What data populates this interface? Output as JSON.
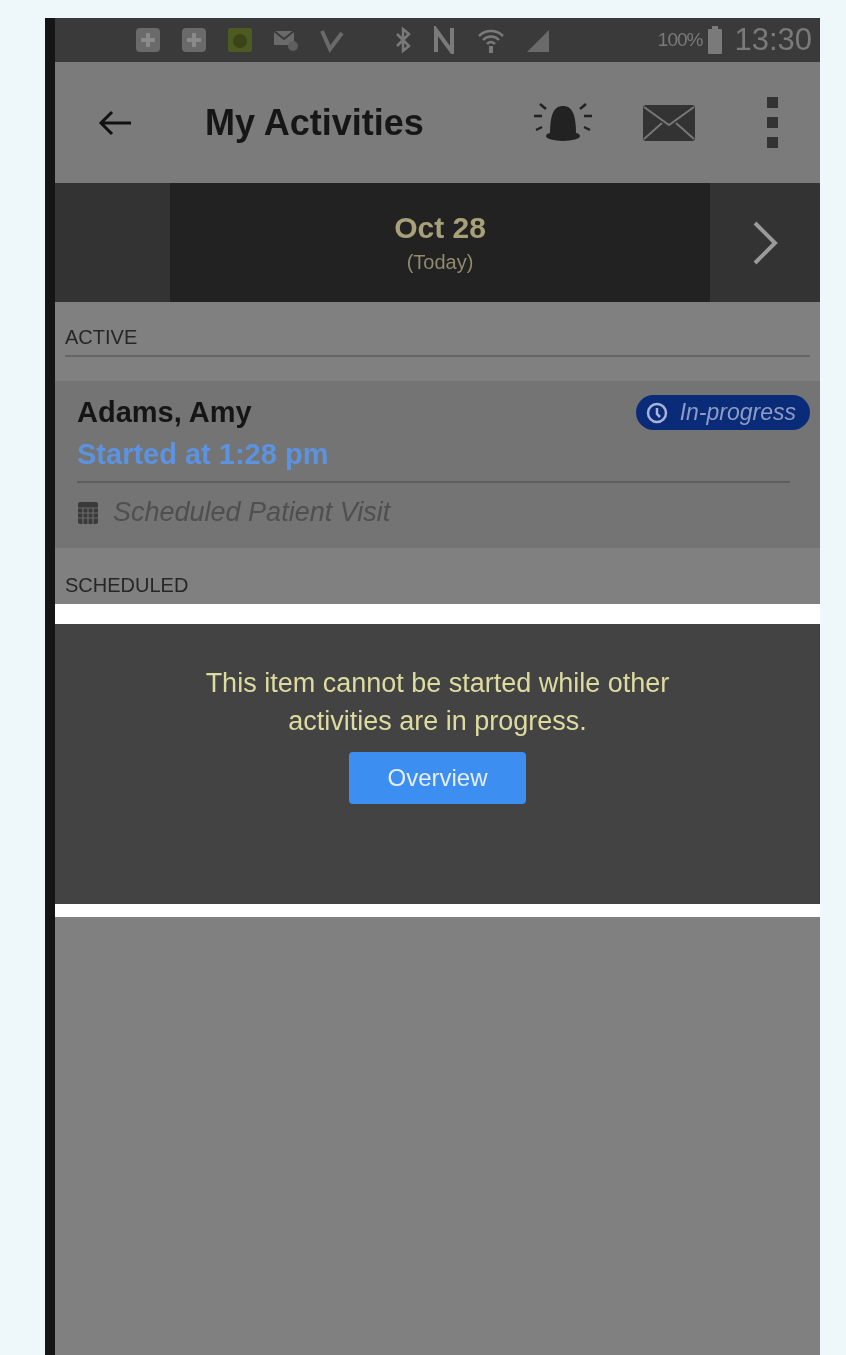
{
  "status_bar": {
    "battery": "100%",
    "time": "13:30"
  },
  "app_bar": {
    "title": "My Activities"
  },
  "date_bar": {
    "date": "Oct 28",
    "note": "(Today)"
  },
  "sections": [
    {
      "header": "ACTIVE",
      "items": [
        {
          "name": "Adams, Amy",
          "started": "Started at 1:28 pm",
          "type": "Scheduled Patient Visit",
          "badge": "In-progress"
        }
      ]
    },
    {
      "header": "SCHEDULED"
    }
  ],
  "toast": {
    "message": "This item cannot be started while other activities are in progress.",
    "button": "Overview"
  }
}
